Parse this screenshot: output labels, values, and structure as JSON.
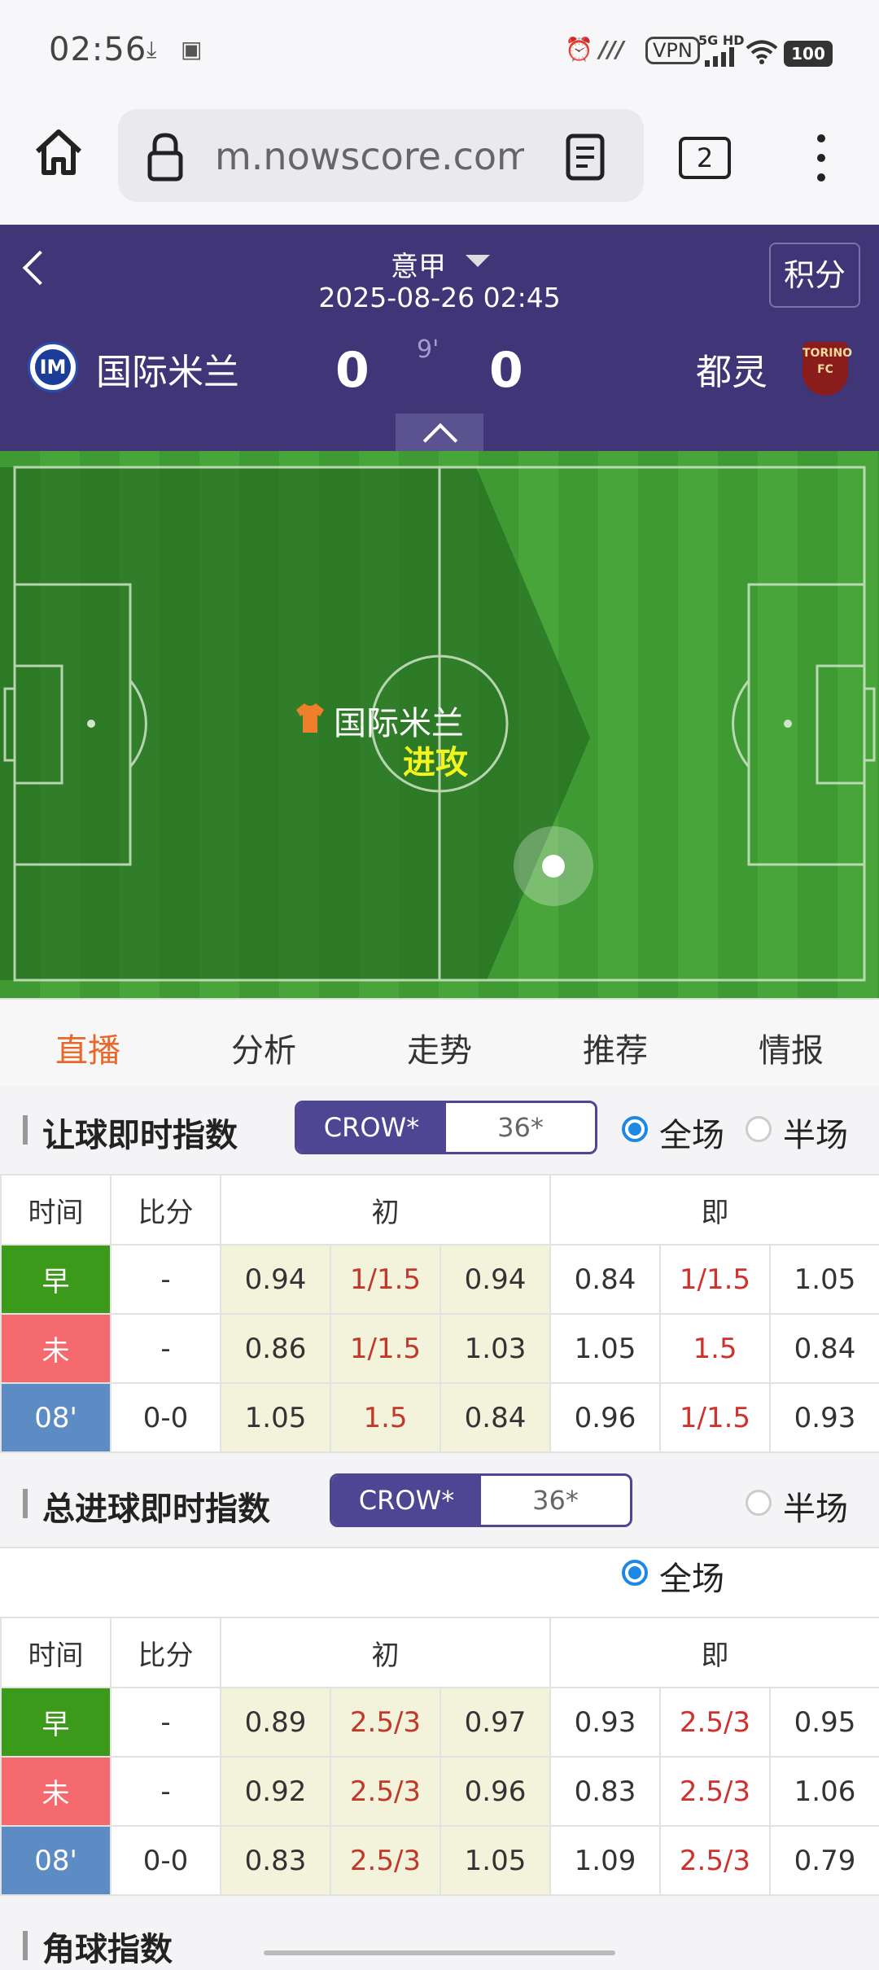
{
  "status_bar": {
    "time": "02:56",
    "icons": [
      "download-icon",
      "package-icon",
      "alarm-icon",
      "signal-icon",
      "vpn-badge",
      "5g-hd-signal-icon",
      "wifi-icon",
      "battery-icon"
    ],
    "vpn": "VPN",
    "network": "5G HD",
    "battery": "100"
  },
  "browser": {
    "url": "m.nowscore.com/",
    "tab_count": "2"
  },
  "match": {
    "league": "意甲",
    "datetime": "2025-08-26 02:45",
    "standings_label": "积分",
    "home_team": "国际米兰",
    "away_team": "都灵",
    "home_score": "0",
    "away_score": "0",
    "minute": "9'",
    "home_logo_text": "IM",
    "away_logo_text": "TORINO FC"
  },
  "pitch": {
    "attacking_team": "国际米兰",
    "action": "进攻"
  },
  "tabs": [
    "直播",
    "分析",
    "走势",
    "推荐",
    "情报"
  ],
  "active_tab": 0,
  "handicap": {
    "title": "让球即时指数",
    "bookmakers": [
      "CROW*",
      "36*"
    ],
    "radio_full": "全场",
    "radio_half": "半场",
    "headers": [
      "时间",
      "比分",
      "初",
      "即"
    ],
    "rows": [
      {
        "time": "早",
        "score": "-",
        "init": [
          "0.94",
          "1/1.5",
          "0.94"
        ],
        "live": [
          "0.84",
          "1/1.5",
          "1.05"
        ]
      },
      {
        "time": "未",
        "score": "-",
        "init": [
          "0.86",
          "1/1.5",
          "1.03"
        ],
        "live": [
          "1.05",
          "1.5",
          "0.84"
        ]
      },
      {
        "time": "08'",
        "score": "0-0",
        "init": [
          "1.05",
          "1.5",
          "0.84"
        ],
        "live": [
          "0.96",
          "1/1.5",
          "0.93"
        ]
      }
    ]
  },
  "totals": {
    "title": "总进球即时指数",
    "bookmakers": [
      "CROW*",
      "36*"
    ],
    "radio_half": "半场",
    "radio_full": "全场",
    "headers": [
      "时间",
      "比分",
      "初",
      "即"
    ],
    "rows": [
      {
        "time": "早",
        "score": "-",
        "init": [
          "0.89",
          "2.5/3",
          "0.97"
        ],
        "live": [
          "0.93",
          "2.5/3",
          "0.95"
        ]
      },
      {
        "time": "未",
        "score": "-",
        "init": [
          "0.92",
          "2.5/3",
          "0.96"
        ],
        "live": [
          "0.83",
          "2.5/3",
          "1.06"
        ]
      },
      {
        "time": "08'",
        "score": "0-0",
        "init": [
          "0.83",
          "2.5/3",
          "1.05"
        ],
        "live": [
          "1.09",
          "2.5/3",
          "0.79"
        ]
      }
    ]
  },
  "corners": {
    "title": "角球指数"
  }
}
